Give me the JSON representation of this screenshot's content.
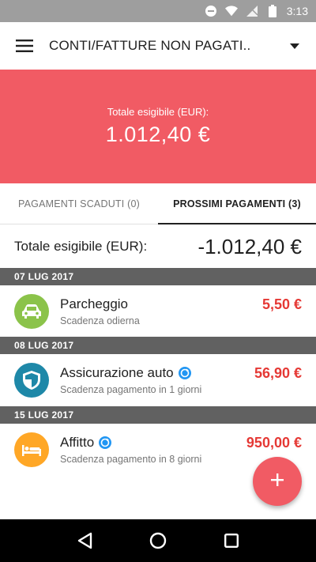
{
  "status_bar": {
    "time": "3:13",
    "icons": [
      "dnd-icon",
      "wifi-icon",
      "signal-icon",
      "battery-icon"
    ]
  },
  "toolbar": {
    "title": "CONTI/FATTURE NON PAGATI..",
    "menu_icon": "hamburger-menu-icon",
    "dropdown_icon": "dropdown-arrow-icon"
  },
  "hero": {
    "label": "Totale esigibile (EUR):",
    "value": "1.012,40 €",
    "color": "#f15b64"
  },
  "tabs": [
    {
      "label": "PAGAMENTI SCADUTI (0)",
      "active": false
    },
    {
      "label": "PROSSIMI PAGAMENTI (3)",
      "active": true
    }
  ],
  "total": {
    "label": "Totale esigibile (EUR):",
    "value": "-1.012,40 €"
  },
  "groups": [
    {
      "date": "07 LUG 2017",
      "items": [
        {
          "name": "Parcheggio",
          "subtitle": "Scadenza odierna",
          "amount": "5,50 €",
          "icon": "car-icon",
          "color": "#8bc34a",
          "recurring": false
        }
      ]
    },
    {
      "date": "08 LUG 2017",
      "items": [
        {
          "name": "Assicurazione auto",
          "subtitle": "Scadenza pagamento in 1 giorni",
          "amount": "56,90 €",
          "icon": "shield-icon",
          "color": "#1e88a8",
          "recurring": true
        }
      ]
    },
    {
      "date": "15 LUG 2017",
      "items": [
        {
          "name": "Affitto",
          "subtitle": "Scadenza pagamento in 8 giorni",
          "amount": "950,00 €",
          "icon": "bed-icon",
          "color": "#ffa726",
          "recurring": true
        }
      ]
    }
  ],
  "fab": {
    "icon": "add-icon"
  },
  "nav_bar": {
    "icons": [
      "back-icon",
      "home-icon",
      "recents-icon"
    ]
  },
  "colors": {
    "accent": "#f15b64",
    "amount_red": "#e53935",
    "header_gray": "#616161",
    "recurring_blue": "#2196f3"
  }
}
